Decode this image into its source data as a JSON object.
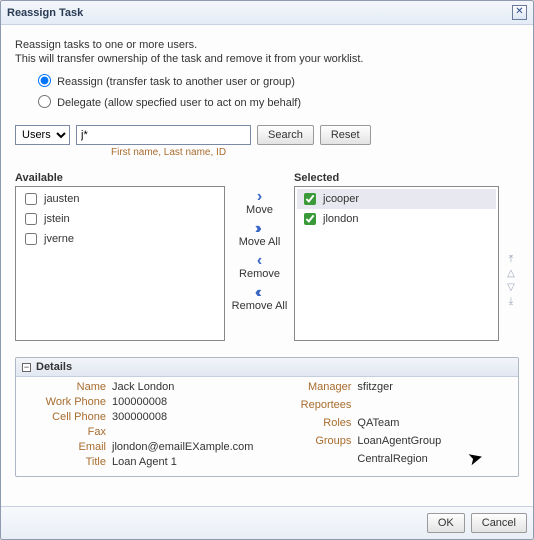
{
  "window": {
    "title": "Reassign Task"
  },
  "intro": {
    "line1": "Reassign tasks to one or more users.",
    "line2": "This will transfer ownership of the task and remove it from your worklist."
  },
  "options": {
    "reassign": "Reassign (transfer task to another user or group)",
    "delegate": "Delegate (allow specfied user to act on my behalf)"
  },
  "search": {
    "scope": "Users",
    "query": "j*",
    "hint": "First name, Last name, ID",
    "search_btn": "Search",
    "reset_btn": "Reset"
  },
  "picker": {
    "available_label": "Available",
    "selected_label": "Selected",
    "available": [
      "jausten",
      "jstein",
      "jverne"
    ],
    "selected": [
      "jcooper",
      "jlondon"
    ],
    "actions": {
      "move": "Move",
      "move_all": "Move All",
      "remove": "Remove",
      "remove_all": "Remove All"
    }
  },
  "details": {
    "header": "Details",
    "left": {
      "name_lbl": "Name",
      "name": "Jack London",
      "workphone_lbl": "Work Phone",
      "workphone": "100000008",
      "cellphone_lbl": "Cell Phone",
      "cellphone": "300000008",
      "fax_lbl": "Fax",
      "fax": "",
      "email_lbl": "Email",
      "email": "jlondon@emailEXample.com",
      "title_lbl": "Title",
      "title": "Loan Agent 1"
    },
    "right": {
      "manager_lbl": "Manager",
      "manager": "sfitzger",
      "reportees_lbl": "Reportees",
      "reportees": "",
      "roles_lbl": "Roles",
      "roles": "QATeam",
      "groups_lbl": "Groups",
      "groups1": "LoanAgentGroup",
      "groups2": "CentralRegion"
    }
  },
  "footer": {
    "ok": "OK",
    "cancel": "Cancel"
  }
}
